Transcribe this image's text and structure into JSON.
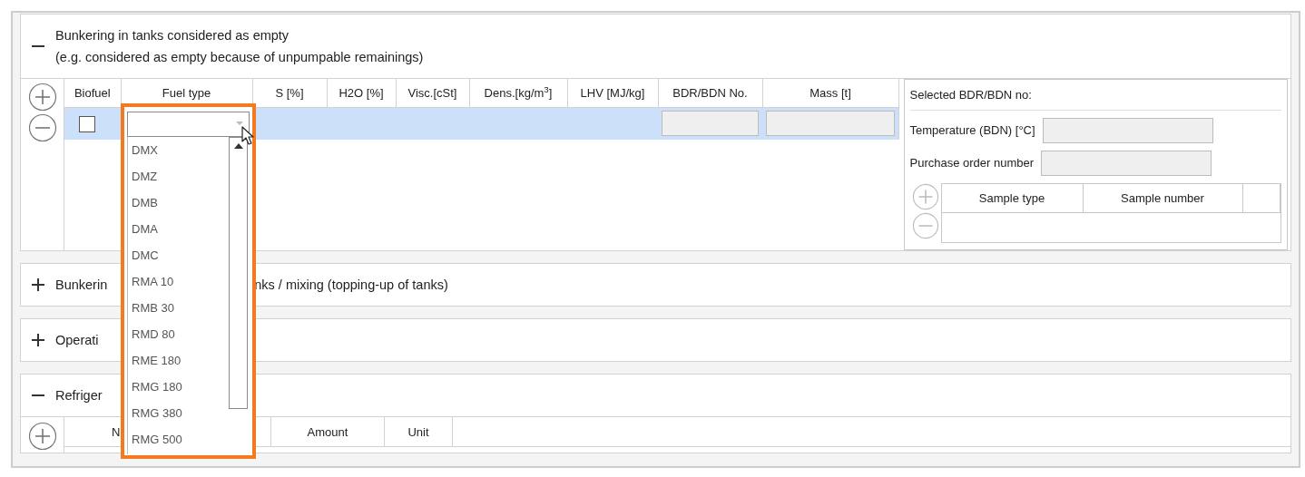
{
  "sections": [
    {
      "kind": "fuel",
      "expanded": true,
      "title": "Bunkering in tanks considered as empty",
      "subtitle": "(e.g. considered as empty because of unpumpable remainings)",
      "table": {
        "columns": [
          "Biofuel",
          "Fuel type",
          "S [%]",
          "H2O [%]",
          "Visc.[cSt]",
          "Dens.[kg/m$^{3}$]",
          "LHV [MJ/kg]",
          "BDR/BDN No.",
          "Mass [t]"
        ],
        "rows": [
          {
            "selected": true,
            "biofuel": false
          }
        ]
      },
      "details": {
        "heading": "Selected BDR/BDN no:",
        "fields": [
          {
            "label": "Temperature (BDN) [°C]"
          },
          {
            "label": "Purchase order number"
          }
        ],
        "sample_columns": [
          "Sample type",
          "Sample number"
        ]
      }
    },
    {
      "kind": "plain",
      "expanded": false,
      "title_parts": [
        "Bunkerin",
        "nks / mixing (topping-up of tanks)"
      ]
    },
    {
      "kind": "plain",
      "expanded": false,
      "title_parts": [
        "Operati"
      ]
    },
    {
      "kind": "refrigerant",
      "expanded": true,
      "title_parts": [
        "Refriger"
      ],
      "columns": [
        "N",
        "Amount",
        "Unit"
      ]
    }
  ],
  "dropdown": {
    "highlighted": true,
    "options": [
      "DMX",
      "DMZ",
      "DMB",
      "DMA",
      "DMC",
      "RMA 10",
      "RMB 30",
      "RMD 80",
      "RME 180",
      "RMG 180",
      "RMG 380",
      "RMG 500"
    ]
  }
}
